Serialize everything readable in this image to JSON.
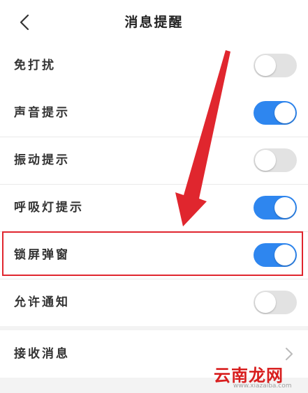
{
  "header": {
    "title": "消息提醒",
    "back_icon": "chevron-left-icon"
  },
  "groups": [
    {
      "rows": [
        {
          "label": "免打扰",
          "control": "toggle",
          "on": false
        }
      ]
    },
    {
      "rows": [
        {
          "label": "声音提示",
          "control": "toggle",
          "on": true
        },
        {
          "label": "振动提示",
          "control": "toggle",
          "on": false
        },
        {
          "label": "呼吸灯提示",
          "control": "toggle",
          "on": true
        },
        {
          "label": "锁屏弹窗",
          "control": "toggle",
          "on": true
        },
        {
          "label": "允许通知",
          "control": "toggle",
          "on": false
        }
      ]
    },
    {
      "rows": [
        {
          "label": "接收消息",
          "control": "chevron"
        }
      ]
    }
  ],
  "colors": {
    "toggle_on": "#2e86ef",
    "toggle_off": "#e2e2e2",
    "annotation": "#e0262e"
  },
  "watermark": {
    "text": "云南龙网",
    "sub": "www.xiazaiba.com"
  }
}
